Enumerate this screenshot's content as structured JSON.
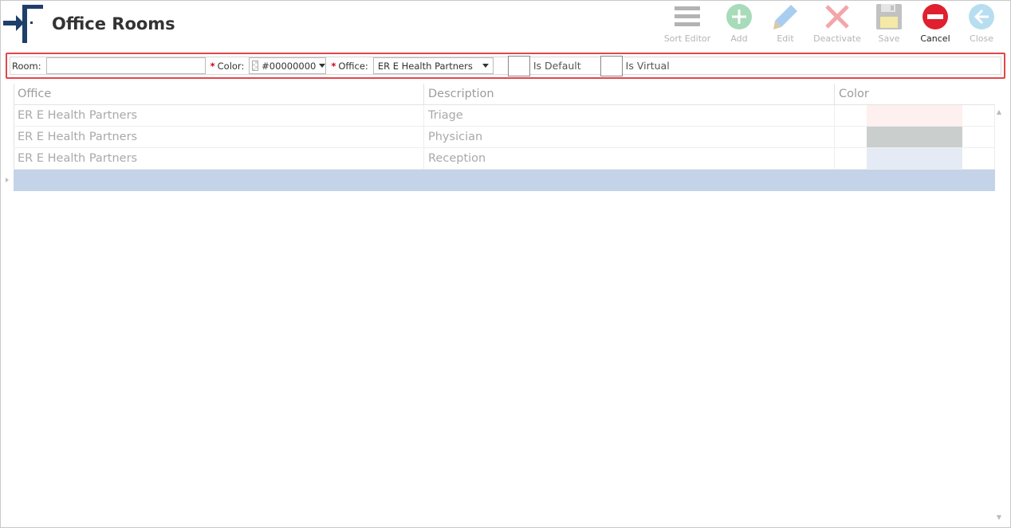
{
  "header": {
    "title": "Office Rooms"
  },
  "toolbar": {
    "sort_editor": "Sort Editor",
    "add": "Add",
    "edit": "Edit",
    "deactivate": "Deactivate",
    "save": "Save",
    "cancel": "Cancel",
    "close": "Close"
  },
  "filter": {
    "room_label": "Room:",
    "room_value": "",
    "required_mark": "*",
    "color_label": "Color:",
    "color_value": "#00000000",
    "office_label": "Office:",
    "office_value": "ER E Health Partners",
    "is_default_label": "Is Default",
    "is_default_checked": false,
    "is_virtual_label": "Is Virtual",
    "is_virtual_checked": false
  },
  "grid": {
    "columns": [
      "Office",
      "Description",
      "Color"
    ],
    "rows": [
      {
        "office": "ER E Health Partners",
        "description": "Triage",
        "color": "#fdf0ee"
      },
      {
        "office": "ER E Health Partners",
        "description": "Physician",
        "color": "#cacecc"
      },
      {
        "office": "ER E Health Partners",
        "description": "Reception",
        "color": "#e5ebf5"
      }
    ]
  },
  "colors": {
    "accent_red": "#e0474c",
    "cancel_red": "#e0202e",
    "new_row": "#c4d3e8",
    "logo_blue": "#1f3f6b"
  }
}
